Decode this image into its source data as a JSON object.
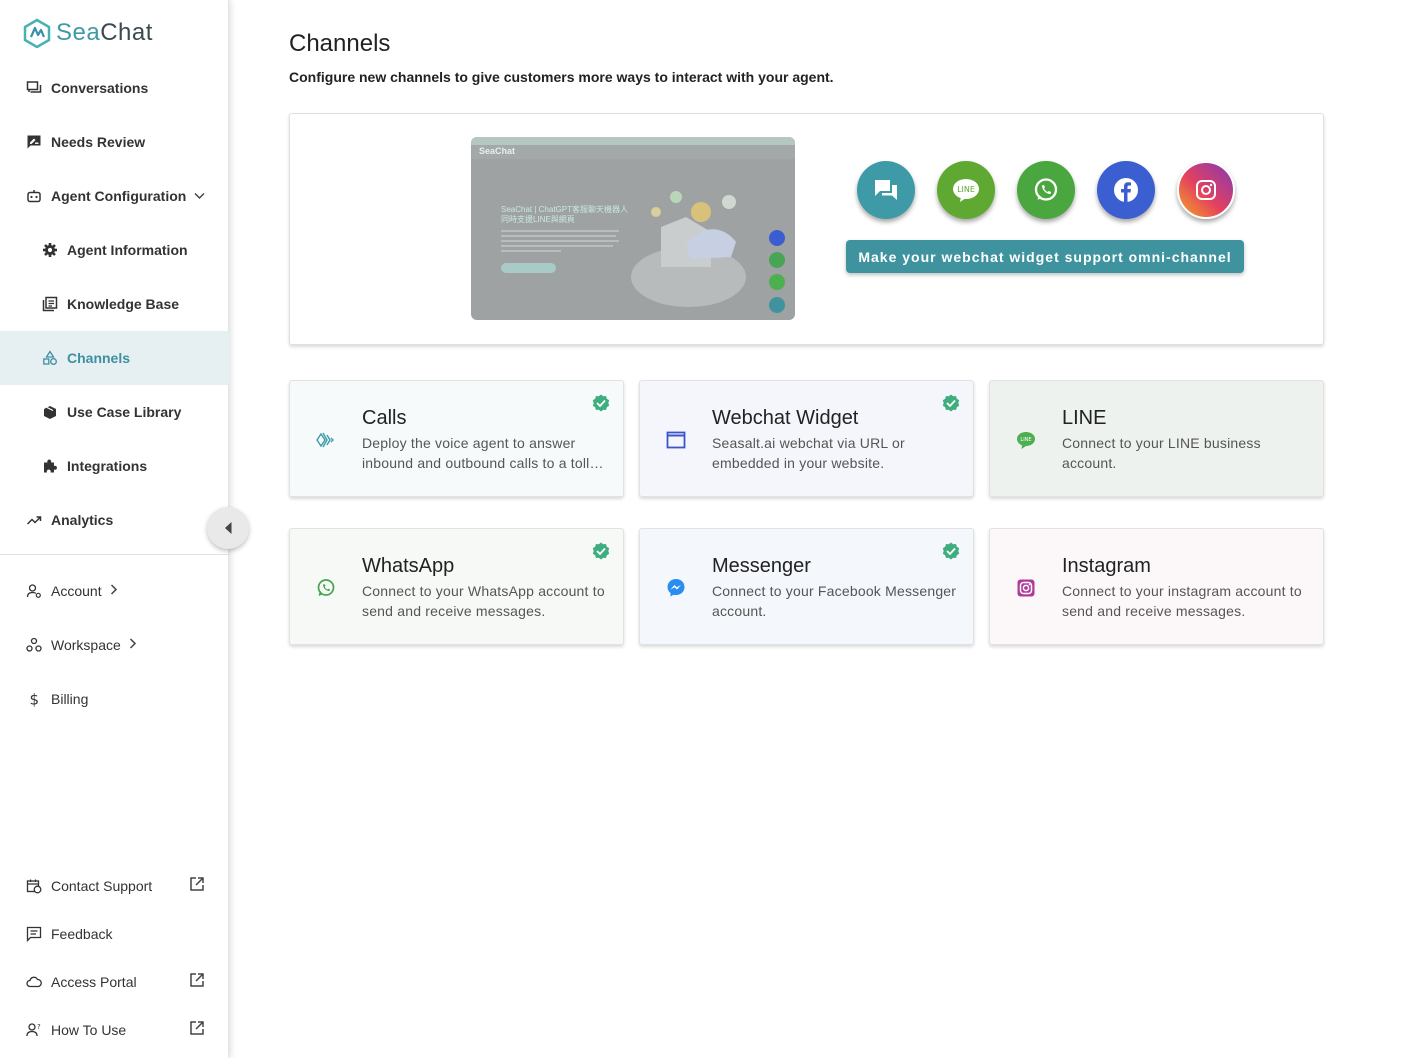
{
  "brand": {
    "name_part1": "Sea",
    "name_part2": "Chat"
  },
  "sidebar": {
    "items": [
      {
        "label": "Conversations"
      },
      {
        "label": "Needs Review"
      },
      {
        "label": "Agent Configuration"
      },
      {
        "label": "Agent Information"
      },
      {
        "label": "Knowledge Base"
      },
      {
        "label": "Channels"
      },
      {
        "label": "Use Case Library"
      },
      {
        "label": "Integrations"
      },
      {
        "label": "Analytics"
      }
    ],
    "bottom": [
      {
        "label": "Account"
      },
      {
        "label": "Workspace"
      },
      {
        "label": "Billing"
      }
    ],
    "footer": [
      {
        "label": "Contact Support"
      },
      {
        "label": "Feedback"
      },
      {
        "label": "Access Portal"
      },
      {
        "label": "How To Use"
      }
    ]
  },
  "main": {
    "title": "Channels",
    "subtitle": "Configure new channels to give customers more ways to interact with your agent.",
    "banner": {
      "omni_button": "Make your webchat widget support omni-channel",
      "preview_logo": "SeaChat",
      "preview_heading": "SeaChat | ChatGPT客服聊天機器人同時支援LINE與網頁",
      "line_badge": "LINE"
    },
    "cards": [
      {
        "title": "Calls",
        "desc": "Deploy the voice agent to answer inbound and outbound calls to a toll…",
        "enabled": true
      },
      {
        "title": "Webchat Widget",
        "desc": "Seasalt.ai webchat via URL or embedded in your website.",
        "enabled": true
      },
      {
        "title": "LINE",
        "desc": "Connect to your LINE business account.",
        "enabled": false,
        "icon_text": "LINE"
      },
      {
        "title": "WhatsApp",
        "desc": "Connect to your WhatsApp account to send and receive messages.",
        "enabled": true
      },
      {
        "title": "Messenger",
        "desc": "Connect to your Facebook Messenger account.",
        "enabled": true
      },
      {
        "title": "Instagram",
        "desc": "Connect to your instagram account to send and receive messages.",
        "enabled": false
      }
    ]
  },
  "colors": {
    "brand_teal": "#3e939e",
    "active_bg": "#e6f0f2",
    "check_green": "#3fae7f",
    "line_green": "#4caf50",
    "whatsapp_green": "#43a34a",
    "facebook_blue": "#3b5fd1",
    "messenger_blue": "#2a8df2"
  }
}
